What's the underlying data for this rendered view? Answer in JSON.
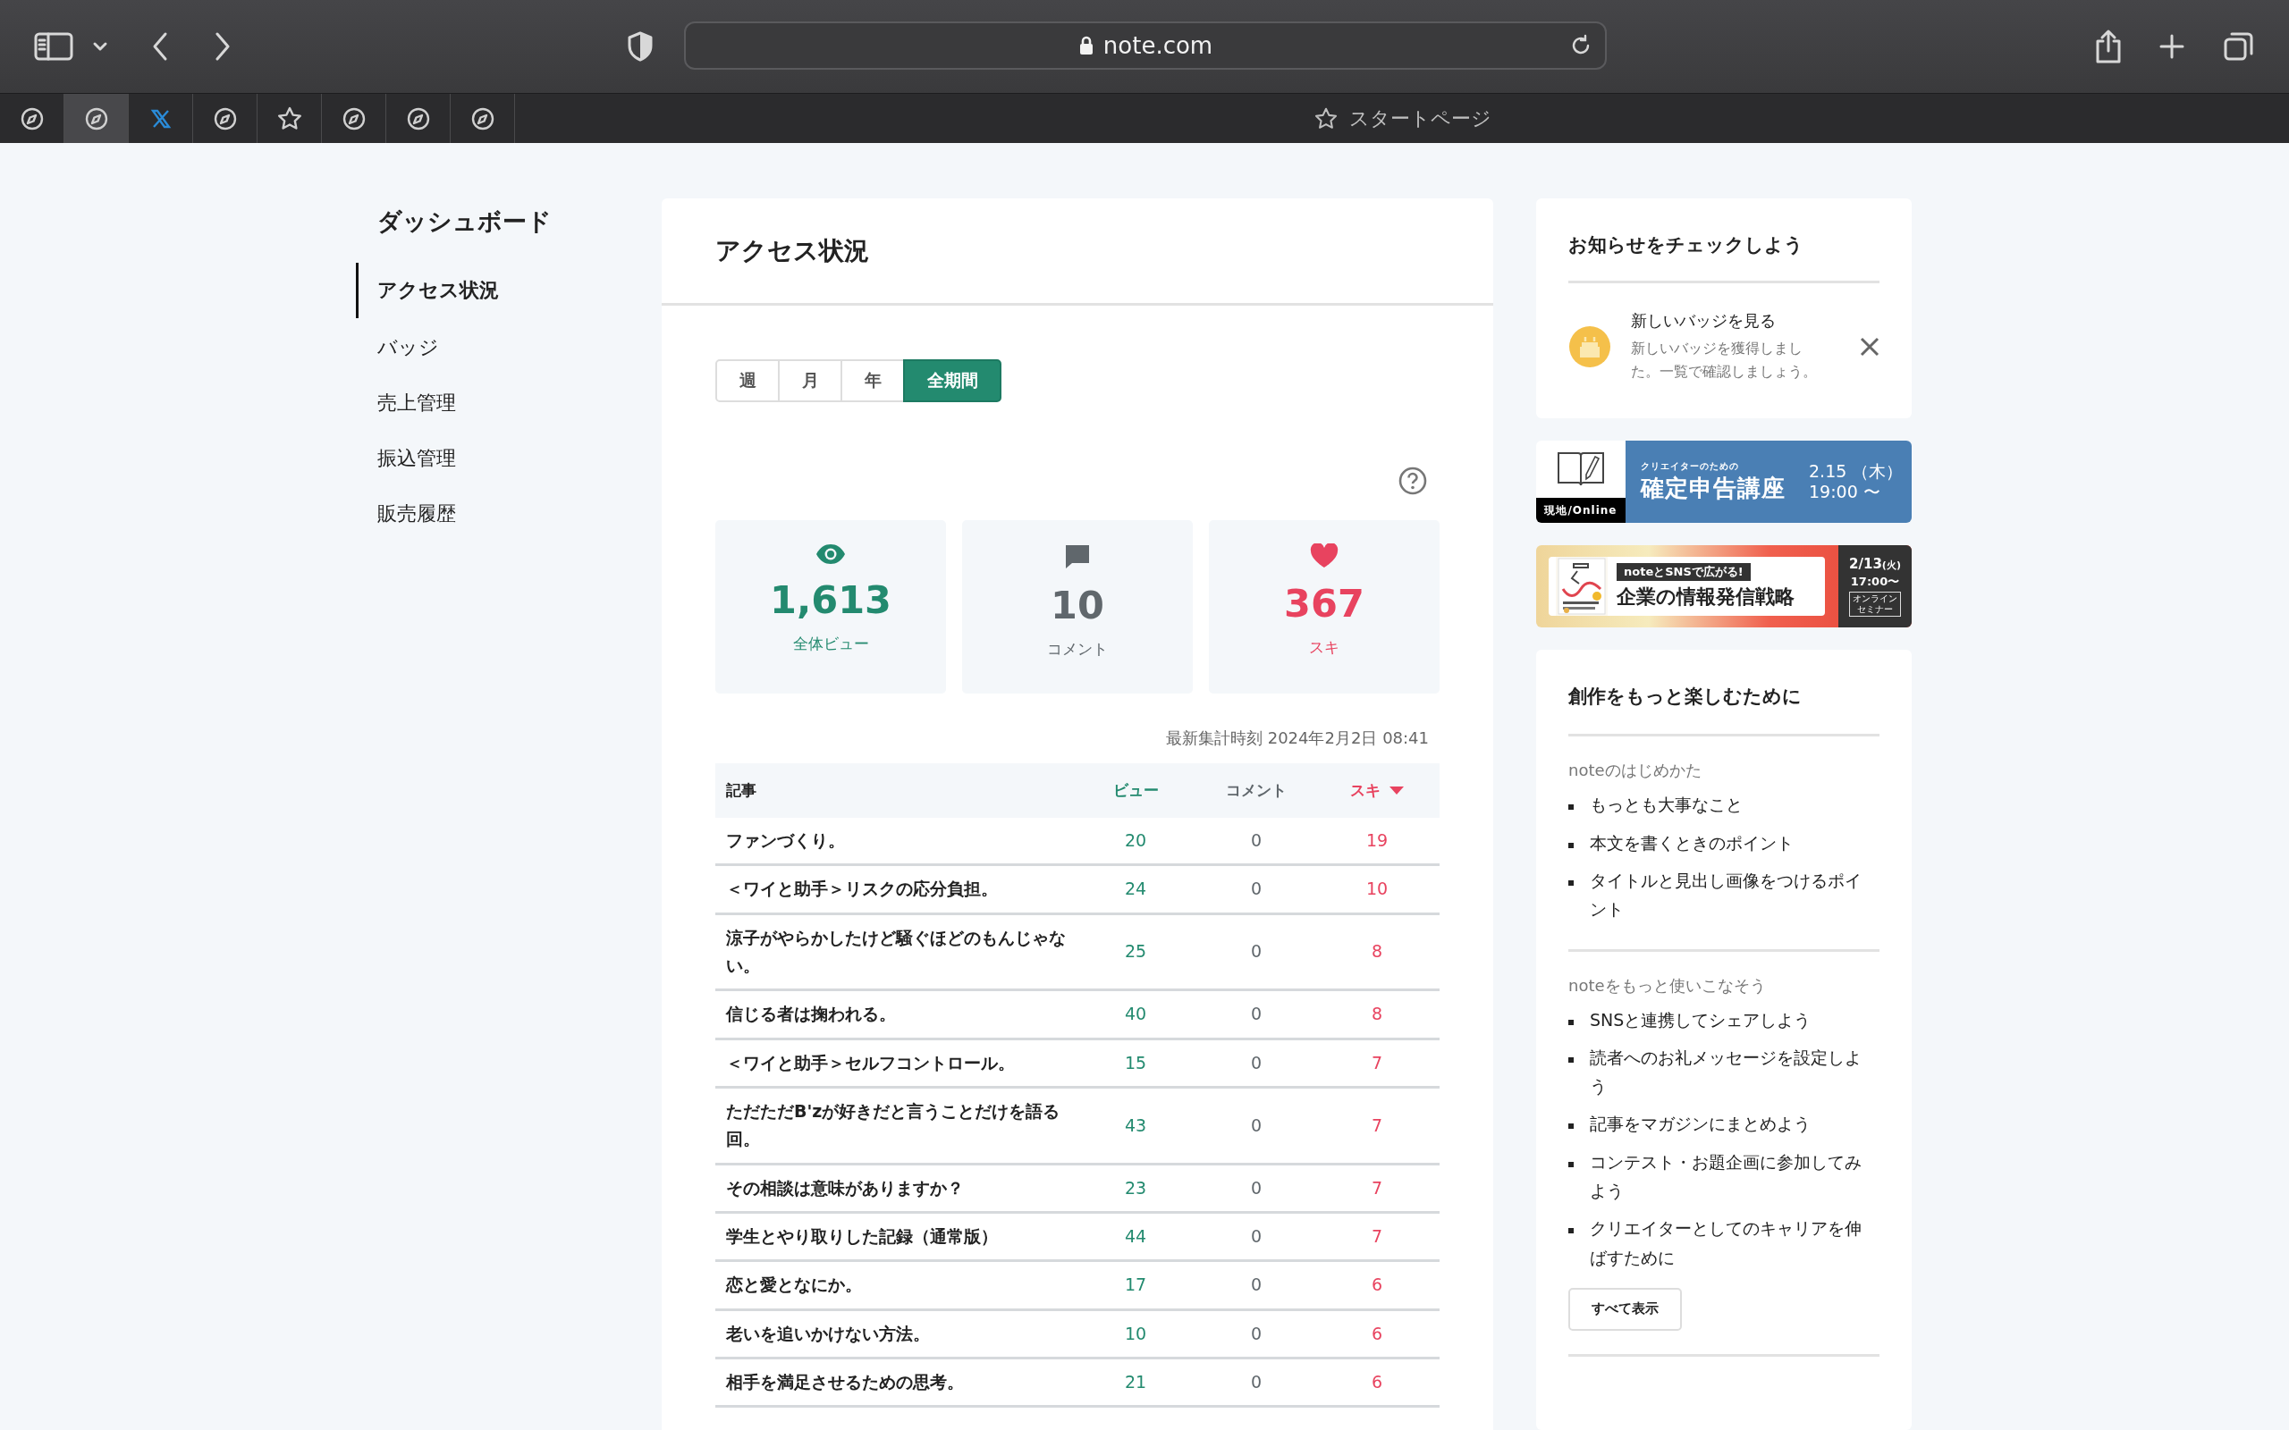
{
  "browser": {
    "url": "note.com",
    "tabs": [
      {
        "kind": "compass",
        "selected": false
      },
      {
        "kind": "compass",
        "selected": true
      },
      {
        "kind": "x",
        "selected": false
      },
      {
        "kind": "compass",
        "selected": false
      },
      {
        "kind": "star",
        "selected": false
      },
      {
        "kind": "compass",
        "selected": false
      },
      {
        "kind": "compass",
        "selected": false
      },
      {
        "kind": "compass",
        "selected": false
      }
    ],
    "start_page": "スタートページ"
  },
  "sidebar": {
    "title": "ダッシュボード",
    "items": [
      {
        "label": "アクセス状況",
        "selected": true
      },
      {
        "label": "バッジ",
        "selected": false
      },
      {
        "label": "売上管理",
        "selected": false
      },
      {
        "label": "振込管理",
        "selected": false
      },
      {
        "label": "販売履歴",
        "selected": false
      }
    ]
  },
  "main": {
    "title": "アクセス状況",
    "periods": [
      {
        "label": "週",
        "selected": false
      },
      {
        "label": "月",
        "selected": false
      },
      {
        "label": "年",
        "selected": false
      },
      {
        "label": "全期間",
        "selected": true
      }
    ],
    "stats": [
      {
        "kind": "views",
        "value": "1,613",
        "label": "全体ビュー"
      },
      {
        "kind": "comments",
        "value": "10",
        "label": "コメント"
      },
      {
        "kind": "likes",
        "value": "367",
        "label": "スキ"
      }
    ],
    "updated": "最新集計時刻 2024年2月2日 08:41",
    "table": {
      "columns": [
        {
          "kind": "title",
          "label": "記事",
          "sorted": false
        },
        {
          "kind": "views",
          "label": "ビュー",
          "sorted": false
        },
        {
          "kind": "comments",
          "label": "コメント",
          "sorted": false
        },
        {
          "kind": "likes",
          "label": "スキ",
          "sorted": true
        }
      ],
      "rows": [
        {
          "title": "ファンづくり。",
          "views": "20",
          "comments": "0",
          "likes": "19"
        },
        {
          "title": "＜ワイと助手＞リスクの応分負担。",
          "views": "24",
          "comments": "0",
          "likes": "10"
        },
        {
          "title": "涼子がやらかしたけど騒ぐほどのもんじゃない。",
          "views": "25",
          "comments": "0",
          "likes": "8"
        },
        {
          "title": "信じる者は掬われる。",
          "views": "40",
          "comments": "0",
          "likes": "8"
        },
        {
          "title": "＜ワイと助手＞セルフコントロール。",
          "views": "15",
          "comments": "0",
          "likes": "7"
        },
        {
          "title": "ただただB'zが好きだと言うことだけを語る回。",
          "views": "43",
          "comments": "0",
          "likes": "7"
        },
        {
          "title": "その相談は意味がありますか？",
          "views": "23",
          "comments": "0",
          "likes": "7"
        },
        {
          "title": "学生とやり取りした記録（通常版）",
          "views": "44",
          "comments": "0",
          "likes": "7"
        },
        {
          "title": "恋と愛となにか。",
          "views": "17",
          "comments": "0",
          "likes": "6"
        },
        {
          "title": "老いを追いかけない方法。",
          "views": "10",
          "comments": "0",
          "likes": "6"
        },
        {
          "title": "相手を満足させるための思考。",
          "views": "21",
          "comments": "0",
          "likes": "6"
        }
      ]
    }
  },
  "notice": {
    "title": "お知らせをチェックしよう",
    "items": [
      {
        "title": "新しいバッジを見る",
        "text": "新しいバッジを獲得しました。一覧で確認しましょう。"
      }
    ]
  },
  "banners": [
    {
      "kind": "seminar",
      "badge": "現地/Online",
      "subtitle": "クリエイターのための",
      "title": "確定申告講座",
      "date": "2.15 （木）",
      "time": "19:00 〜"
    },
    {
      "kind": "webinar",
      "tag": "noteとSNSで広がる!",
      "title": "企業の情報発信戦略",
      "date": "2/13",
      "weekday": "(火)",
      "time": "17:00〜",
      "format": [
        "オンライン",
        "セミナー"
      ]
    }
  ],
  "guide": {
    "title": "創作をもっと楽しむために",
    "sections": [
      {
        "heading": "noteのはじめかた",
        "links": [
          "もっとも大事なこと",
          "本文を書くときのポイント",
          "タイトルと見出し画像をつけるポイント"
        ]
      },
      {
        "heading": "noteをもっと使いこなそう",
        "links": [
          "SNSと連携してシェアしよう",
          "読者へのお礼メッセージを設定しよう",
          "記事をマガジンにまとめよう",
          "コンテスト・お題企画に参加してみよう",
          "クリエイターとしてのキャリアを伸ばすために"
        ]
      }
    ],
    "button": "すべて表示"
  }
}
